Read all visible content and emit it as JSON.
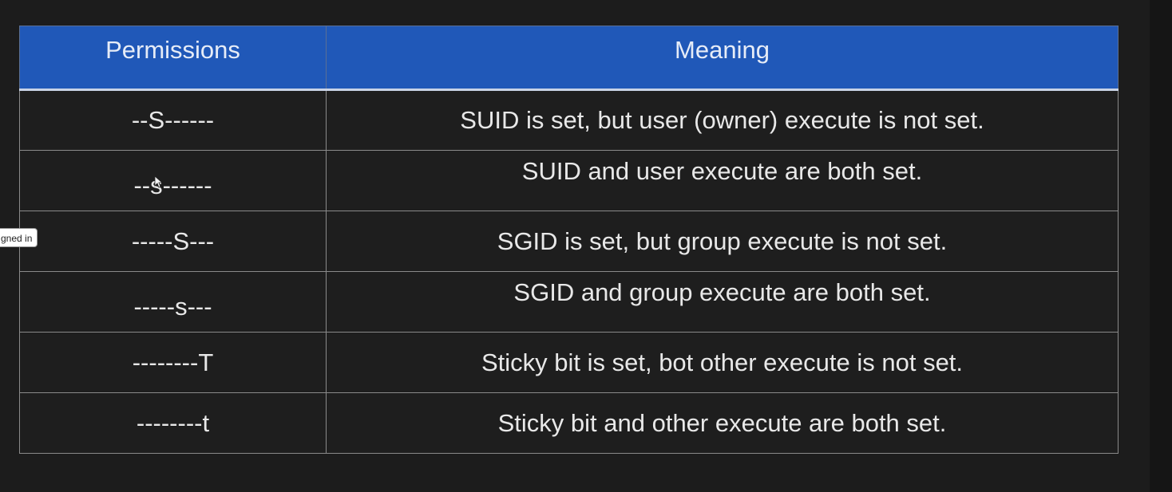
{
  "table": {
    "headers": [
      "Permissions",
      "Meaning"
    ],
    "rows": [
      {
        "permission": "--S------",
        "meaning": "SUID is set, but user (owner) execute is not set."
      },
      {
        "permission": "--s------",
        "meaning": "SUID and user execute are both set."
      },
      {
        "permission": "-----S---",
        "meaning": "SGID is set, but group execute is not set."
      },
      {
        "permission": "-----s---",
        "meaning": "SGID and group execute are both set."
      },
      {
        "permission": "--------T",
        "meaning": "Sticky bit is set, bot other execute is not set."
      },
      {
        "permission": "--------t",
        "meaning": "Sticky bit and other execute are both set."
      }
    ]
  },
  "tooltip": {
    "text": "gned in"
  },
  "colors": {
    "header_bg": "#2058b8",
    "page_bg": "#1c1c1c",
    "grid_line": "#8a8a8a"
  }
}
